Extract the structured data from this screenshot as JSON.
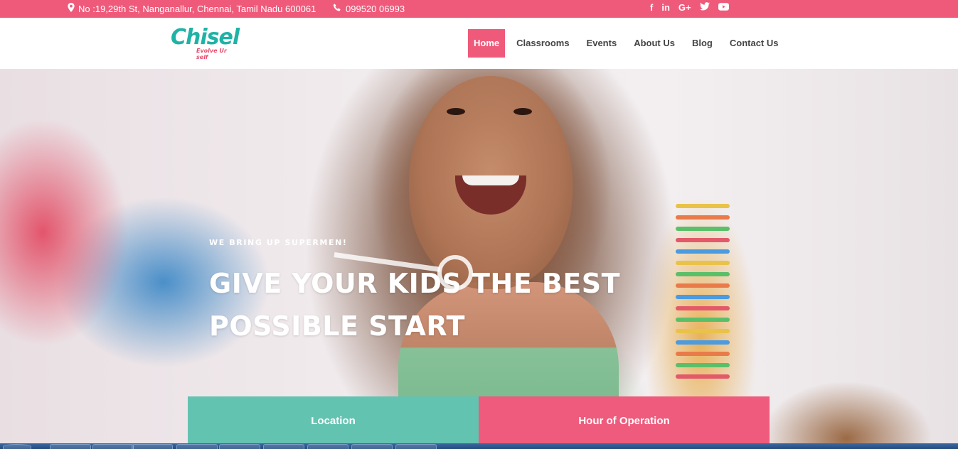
{
  "topbar": {
    "address": "No :19,29th St, Nanganallur, Chennai, Tamil Nadu 600061",
    "phone": "099520 06993",
    "social": [
      "f",
      "in",
      "G+",
      "twitter",
      "youtube"
    ]
  },
  "brand": {
    "logo_text": "Chisel",
    "logo_tagline": "Evolve Ur self"
  },
  "nav": {
    "items": [
      "Home",
      "Classrooms",
      "Events",
      "About Us",
      "Blog",
      "Contact Us"
    ],
    "active": "Home"
  },
  "hero": {
    "tagline": "WE BRING UP SUPERMEN!",
    "headline_line1": "GIVE YOUR KIDS THE BEST",
    "headline_line2": "POSSIBLE START"
  },
  "info": {
    "location_label": "Location",
    "hours_label": "Hour of Operation"
  },
  "colors": {
    "brand_pink": "#ef5a7a",
    "brand_teal": "#63c3b1",
    "logo_teal": "#1fb3a6"
  }
}
